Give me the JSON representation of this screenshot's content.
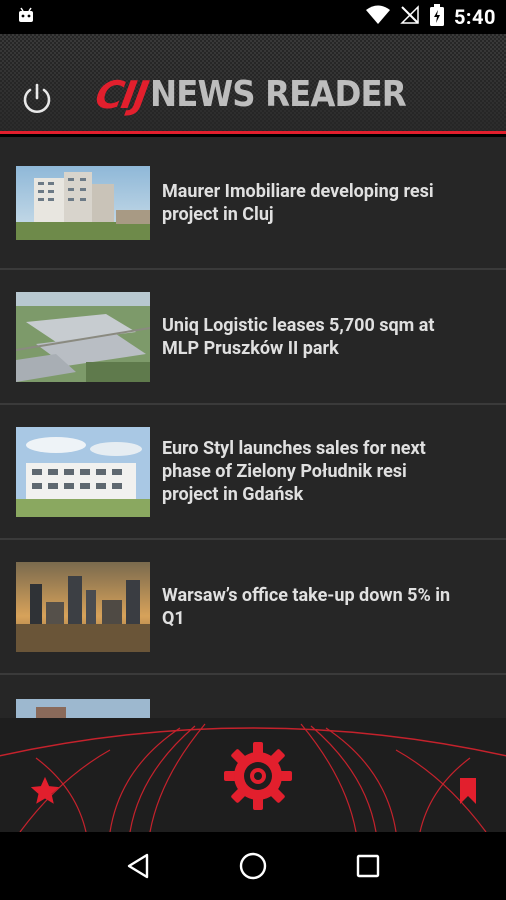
{
  "status_bar": {
    "time": "5:40",
    "icons": [
      "android-icon",
      "wifi-icon",
      "no-signal-icon",
      "battery-icon"
    ]
  },
  "header": {
    "logo_mark": "CIJ",
    "logo_text": "NEWS READER",
    "accent_color": "#e21f2d"
  },
  "articles": [
    {
      "title": "Maurer Imobiliare developing resi project in Cluj"
    },
    {
      "title": "Uniq Logistic leases 5,700 sqm at MLP Pruszków II park"
    },
    {
      "title": "Euro Styl launches sales for next phase of Zielony Południk resi project in Gdańsk"
    },
    {
      "title": "Warsaw’s office take-up down 5% in Q1"
    },
    {
      "title": ""
    }
  ],
  "bottom_bar": {
    "buttons": [
      "favorites",
      "settings",
      "bookmarks"
    ]
  },
  "nav_bar": {
    "buttons": [
      "back",
      "home",
      "recents"
    ]
  }
}
